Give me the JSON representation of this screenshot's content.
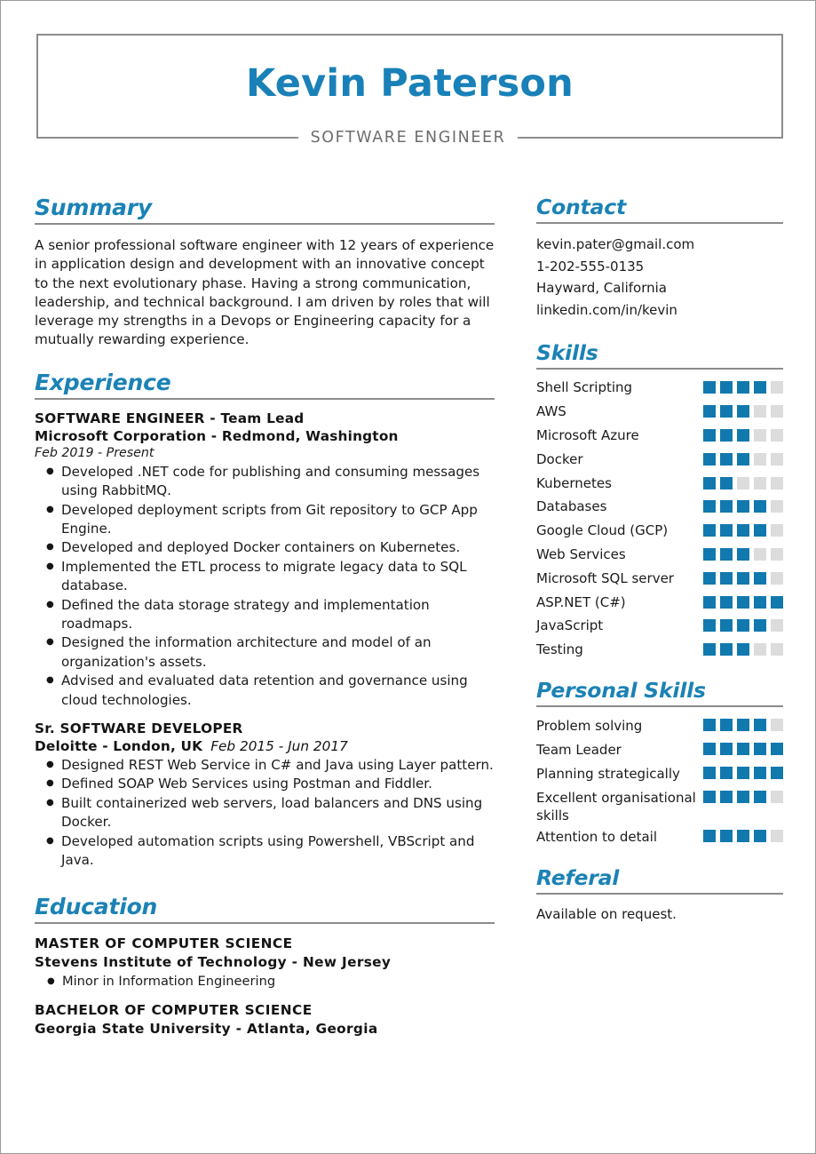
{
  "theme": {
    "accent_blue": "#1981b8",
    "heading_blue": "#1b82b5",
    "square_on": "#1179ae",
    "square_off": "#dcdcdc",
    "rule_gray": "#8c8c8c"
  },
  "header": {
    "name": "Kevin Paterson",
    "subtitle": "SOFTWARE ENGINEER"
  },
  "summary": {
    "title": "Summary",
    "text": "A senior professional software engineer with 12 years of experience in application design and development with an innovative concept to the next evolutionary phase.  Having a strong communication, leadership, and technical background. I am driven by roles that will leverage my strengths in a Devops or Engineering capacity for a mutually rewarding experience."
  },
  "experience": {
    "title": "Experience",
    "jobs": [
      {
        "role": "SOFTWARE ENGINEER - Team Lead",
        "company": "Microsoft Corporation - Redmond, Washington",
        "dates": "Feb 2019 - Present",
        "dates_inline": false,
        "bullets": [
          "Developed .NET code for publishing and consuming messages using RabbitMQ.",
          "Developed deployment scripts from Git repository to GCP App Engine.",
          "Developed and deployed Docker containers on Kubernetes.",
          "Implemented the ETL process to migrate legacy data to SQL database.",
          "Defined the data storage strategy and implementation roadmaps.",
          "Designed the information architecture and model of an organization's assets.",
          "Advised and evaluated data retention and governance using cloud technologies."
        ]
      },
      {
        "role": "Sr. SOFTWARE DEVELOPER",
        "company": "Deloitte - London, UK",
        "dates": "Feb 2015 - Jun 2017",
        "dates_inline": true,
        "bullets": [
          "Designed REST Web Service in C# and Java using Layer pattern.",
          "Defined SOAP Web Services using Postman and Fiddler.",
          "Built containerized web servers, load balancers and DNS using Docker.",
          "Developed automation scripts using Powershell, VBScript and Java."
        ]
      }
    ]
  },
  "education": {
    "title": "Education",
    "entries": [
      {
        "degree": "MASTER OF COMPUTER SCIENCE",
        "school": "Stevens Institute of Technology - New Jersey",
        "bullets": [
          "Minor in Information Engineering"
        ]
      },
      {
        "degree": "BACHELOR OF COMPUTER SCIENCE",
        "school": "Georgia State University - Atlanta, Georgia",
        "bullets": []
      }
    ]
  },
  "contact": {
    "title": "Contact",
    "items": [
      "kevin.pater@gmail.com",
      "1-202-555-0135",
      "Hayward, California",
      "linkedin.com/in/kevin"
    ]
  },
  "skills": {
    "title": "Skills",
    "max_rating": 5,
    "items": [
      {
        "label": "Shell Scripting",
        "rating": 4
      },
      {
        "label": "AWS",
        "rating": 3
      },
      {
        "label": "Microsoft Azure",
        "rating": 3
      },
      {
        "label": "Docker",
        "rating": 3
      },
      {
        "label": "Kubernetes",
        "rating": 2
      },
      {
        "label": "Databases",
        "rating": 4
      },
      {
        "label": "Google Cloud (GCP)",
        "rating": 4
      },
      {
        "label": "Web Services",
        "rating": 3
      },
      {
        "label": "Microsoft SQL server",
        "rating": 4
      },
      {
        "label": "ASP.NET (C#)",
        "rating": 5
      },
      {
        "label": "JavaScript",
        "rating": 4
      },
      {
        "label": "Testing",
        "rating": 3
      }
    ]
  },
  "personal_skills": {
    "title": "Personal Skills",
    "max_rating": 5,
    "items": [
      {
        "label": "Problem solving",
        "rating": 4
      },
      {
        "label": "Team Leader",
        "rating": 5
      },
      {
        "label": "Planning strategically",
        "rating": 5
      },
      {
        "label": "Excellent organisational skills",
        "rating": 4
      },
      {
        "label": "Attention to detail",
        "rating": 4
      }
    ]
  },
  "referral": {
    "title": "Referal",
    "text": "Available on request."
  }
}
